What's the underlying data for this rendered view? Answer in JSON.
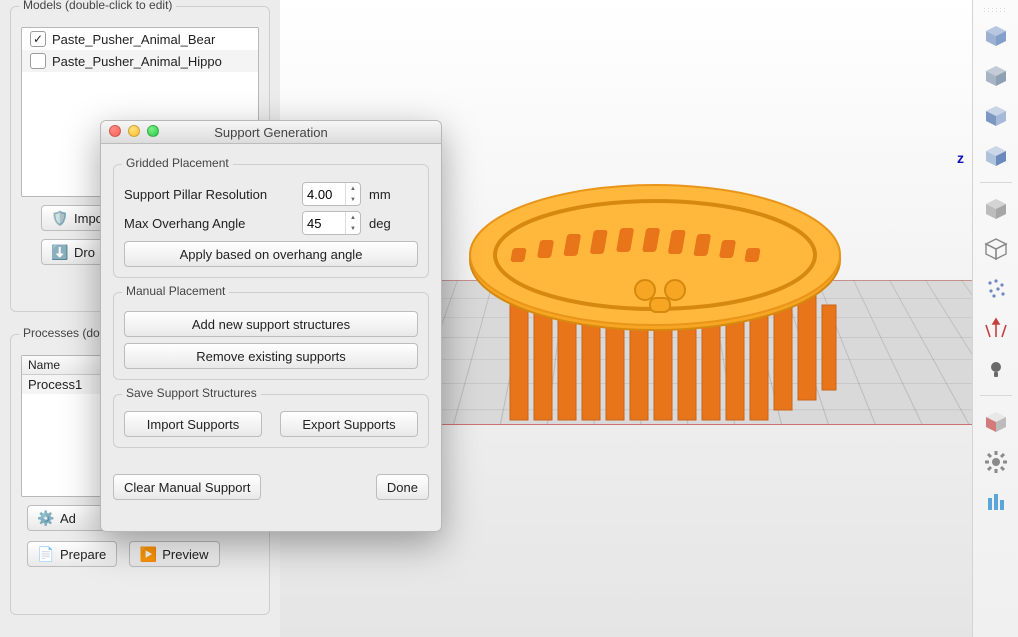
{
  "models_panel": {
    "title": "Models (double-click to edit)",
    "items": [
      {
        "name": "Paste_Pusher_Animal_Bear",
        "checked": true
      },
      {
        "name": "Paste_Pusher_Animal_Hippo",
        "checked": false
      }
    ],
    "import_label": "Impo",
    "drop_label": "Dro"
  },
  "processes_panel": {
    "title": "Processes (doub",
    "header_name": "Name",
    "items": [
      {
        "name": "Process1"
      }
    ],
    "add_label": "Ad",
    "prepare_label": "Prepare",
    "preview_label": "Preview"
  },
  "dialog": {
    "title": "Support Generation",
    "gridded": {
      "title": "Gridded Placement",
      "pillar_label": "Support Pillar Resolution",
      "pillar_value": "4.00",
      "pillar_unit": "mm",
      "overhang_label": "Max Overhang Angle",
      "overhang_value": "45",
      "overhang_unit": "deg",
      "apply_label": "Apply based on overhang angle"
    },
    "manual": {
      "title": "Manual Placement",
      "add_label": "Add new support structures",
      "remove_label": "Remove existing supports"
    },
    "save": {
      "title": "Save Support Structures",
      "import_label": "Import Supports",
      "export_label": "Export Supports"
    },
    "clear_label": "Clear Manual Support",
    "done_label": "Done"
  },
  "viewport": {
    "axis_z": "z"
  },
  "toolbar": {
    "items": [
      "view-top-icon",
      "view-bottom-icon",
      "view-front-icon",
      "view-side-icon",
      "material-solid-icon",
      "material-wire-icon",
      "points-icon",
      "normals-icon",
      "light-icon",
      "section-icon",
      "settings-icon",
      "supports-icon"
    ]
  },
  "colors": {
    "model": "#f6a623",
    "support": "#e8751a"
  }
}
